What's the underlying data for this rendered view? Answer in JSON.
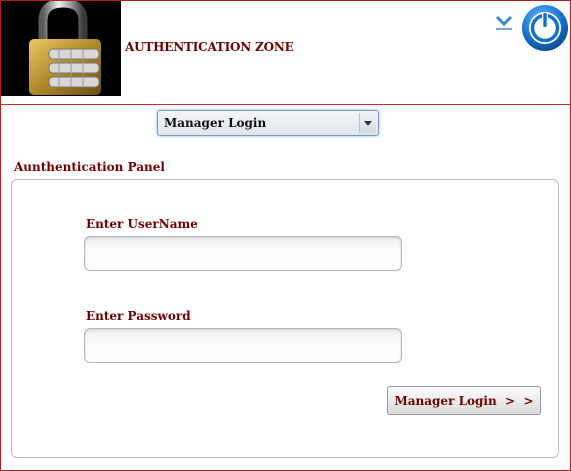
{
  "header": {
    "title": "AUTHENTICATION ZONE",
    "logo_icon": "padlock-icon",
    "menu_icon": "chevron-down-icon",
    "power_icon": "power-icon"
  },
  "login_type": {
    "selected": "Manager Login"
  },
  "panel": {
    "title": "Aunthentication Panel",
    "username_label": "Enter UserName",
    "username_value": "",
    "password_label": "Enter Password",
    "password_value": "",
    "submit_label": "Manager Login  >  >"
  },
  "colors": {
    "accent_text": "#6b0000",
    "frame_border": "#b02020",
    "power_blue": "#1670c8"
  }
}
